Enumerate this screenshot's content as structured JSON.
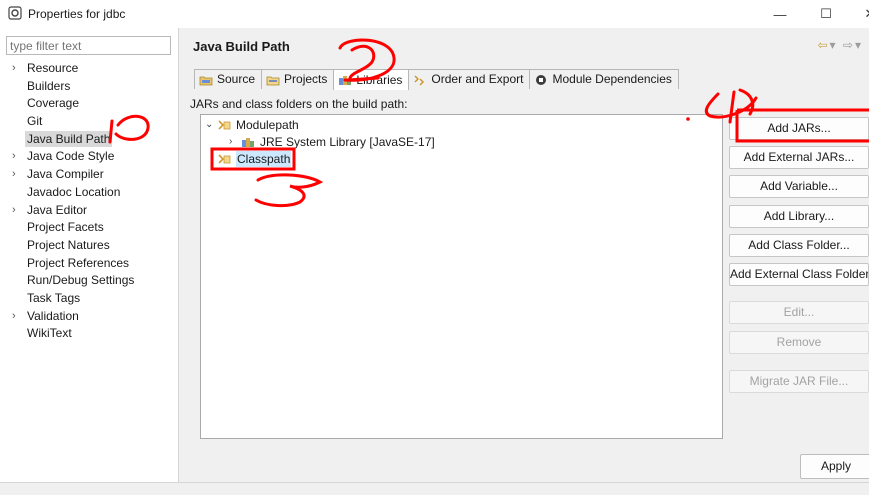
{
  "window": {
    "title": "Properties for jdbc",
    "minimize": "—",
    "maximize": "☐",
    "close": "✕"
  },
  "filter": {
    "placeholder": "type filter text"
  },
  "nav": {
    "items": [
      {
        "label": "Resource",
        "expandable": true
      },
      {
        "label": "Builders",
        "expandable": false
      },
      {
        "label": "Coverage",
        "expandable": false
      },
      {
        "label": "Git",
        "expandable": false
      },
      {
        "label": "Java Build Path",
        "expandable": false,
        "selected": true
      },
      {
        "label": "Java Code Style",
        "expandable": true
      },
      {
        "label": "Java Compiler",
        "expandable": true
      },
      {
        "label": "Javadoc Location",
        "expandable": false
      },
      {
        "label": "Java Editor",
        "expandable": true
      },
      {
        "label": "Project Facets",
        "expandable": false
      },
      {
        "label": "Project Natures",
        "expandable": false
      },
      {
        "label": "Project References",
        "expandable": false
      },
      {
        "label": "Run/Debug Settings",
        "expandable": false
      },
      {
        "label": "Task Tags",
        "expandable": false
      },
      {
        "label": "Validation",
        "expandable": true
      },
      {
        "label": "WikiText",
        "expandable": false
      }
    ]
  },
  "page": {
    "title": "Java Build Path",
    "tabs": [
      {
        "label": "Source",
        "icon": "source-folder-icon"
      },
      {
        "label": "Projects",
        "icon": "projects-icon"
      },
      {
        "label": "Libraries",
        "icon": "libraries-icon",
        "active": true
      },
      {
        "label": "Order and Export",
        "icon": "order-export-icon"
      },
      {
        "label": "Module Dependencies",
        "icon": "module-icon"
      }
    ],
    "section_label": "JARs and class folders on the build path:",
    "tree": {
      "modulepath": "Modulepath",
      "jre": "JRE System Library [JavaSE-17]",
      "classpath": "Classpath"
    },
    "buttons": [
      {
        "label": "Add JARs...",
        "enabled": true
      },
      {
        "label": "Add External JARs...",
        "enabled": true
      },
      {
        "label": "Add Variable...",
        "enabled": true
      },
      {
        "label": "Add Library...",
        "enabled": true
      },
      {
        "label": "Add Class Folder...",
        "enabled": true
      },
      {
        "label": "Add External Class Folder...",
        "enabled": true
      },
      {
        "label": "Edit...",
        "enabled": false
      },
      {
        "label": "Remove",
        "enabled": false
      },
      {
        "label": "Migrate JAR File...",
        "enabled": false
      }
    ],
    "apply_label": "Apply"
  },
  "colors": {
    "annotation": "#ff0000",
    "selection": "#cce8ff",
    "nav_selected": "#d9d9d9"
  }
}
